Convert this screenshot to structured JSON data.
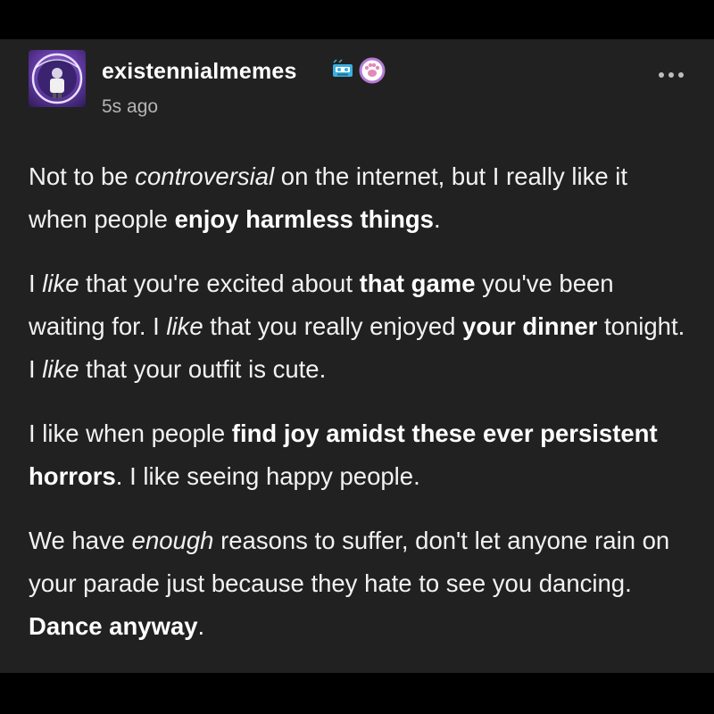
{
  "post": {
    "author": "existennialmemes",
    "timestamp": "5s ago",
    "avatar_icon": "avatar-image",
    "badges": [
      "vhs-tape-badge-icon",
      "cat-paw-badge-icon"
    ],
    "menu_icon": "more-options-icon",
    "colors": {
      "background": "#212121",
      "page_background": "#000000",
      "text": "#ffffff",
      "muted": "#b5b5b5",
      "badge_blue": "#3ab0e0",
      "badge_purple": "#b57ad6"
    }
  },
  "body": {
    "p1": {
      "s1": "Not to be ",
      "em1": "controversial",
      "s2": " on the internet, but I really like it when people ",
      "b1": "enjoy harmless things",
      "s3": "."
    },
    "p2": {
      "s1": "I ",
      "em1": "like",
      "s2": " that you're excited about ",
      "b1": "that game",
      "s3": " you've been waiting for. I ",
      "em2": "like",
      "s4": " that you really enjoyed ",
      "b2": "your dinner",
      "s5": " tonight. I ",
      "em3": "like",
      "s6": " that your outfit is cute."
    },
    "p3": {
      "s1": "I like when people ",
      "b1": "find joy amidst these ever persistent horrors",
      "s2": ". I like seeing happy people."
    },
    "p4": {
      "s1": "We have ",
      "em1": "enough",
      "s2": " reasons to suffer, don't let anyone rain on your parade just because they hate to see you dancing. ",
      "b1": "Dance anyway",
      "s3": "."
    }
  }
}
